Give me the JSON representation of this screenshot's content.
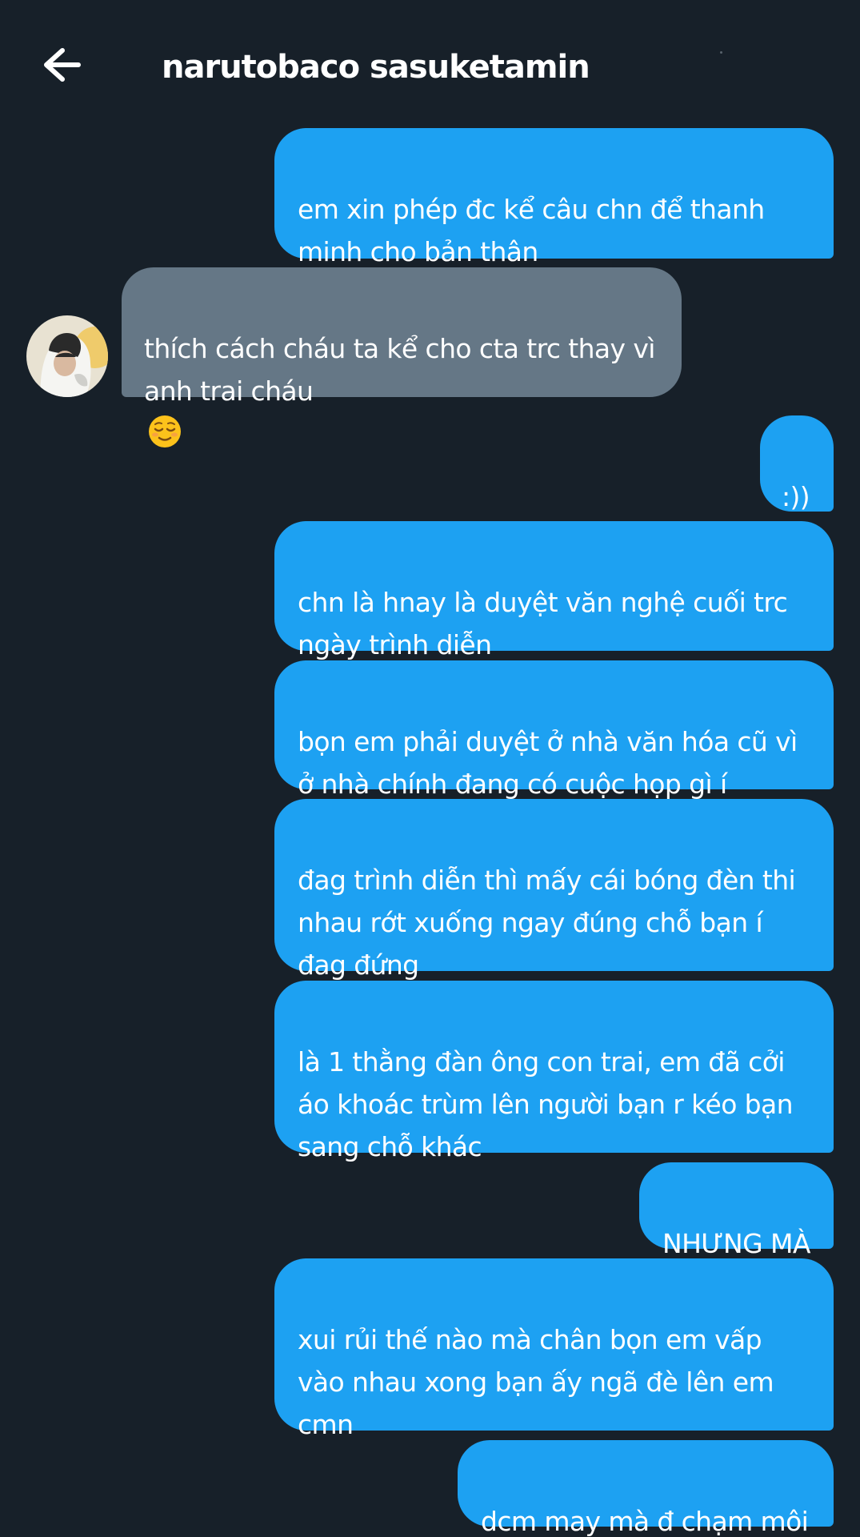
{
  "header": {
    "title": "narutobaco sasuketamin"
  },
  "conversation": {
    "messages": [
      {
        "sender": "me",
        "text": "em xin phép đc kể câu chn để thanh\nminh cho bản thân"
      },
      {
        "sender": "them",
        "text": "thích cách cháu ta kể cho cta trc thay vì\nanh trai cháu",
        "emoji": "relieved-face-icon"
      },
      {
        "sender": "me",
        "text": ":))"
      },
      {
        "sender": "me",
        "text": "chn là hnay là duyệt văn nghệ cuối trc\nngày trình diễn"
      },
      {
        "sender": "me",
        "text": "bọn em phải duyệt ở nhà văn hóa cũ vì\nở nhà chính đang có cuộc họp gì í"
      },
      {
        "sender": "me",
        "text": "đag trình diễn thì mấy cái bóng đèn thi\nnhau rớt xuống ngay đúng chỗ bạn í\nđag đứng"
      },
      {
        "sender": "me",
        "text": "là 1 thằng đàn ông con trai, em đã cởi\náo khoác trùm lên người bạn r kéo bạn\nsang chỗ khác"
      },
      {
        "sender": "me",
        "text": "NHƯNG MÀ"
      },
      {
        "sender": "me",
        "text": "xui rủi thế nào mà chân bọn em vấp\nvào nhau xong bạn ấy ngã đè lên em\ncmn"
      },
      {
        "sender": "me",
        "text": "dcm may mà đ chạm môi"
      }
    ]
  },
  "colors": {
    "background": "#172029",
    "sent_bubble": "#1da1f2",
    "received_bubble": "#657786",
    "text": "#ffffff"
  }
}
